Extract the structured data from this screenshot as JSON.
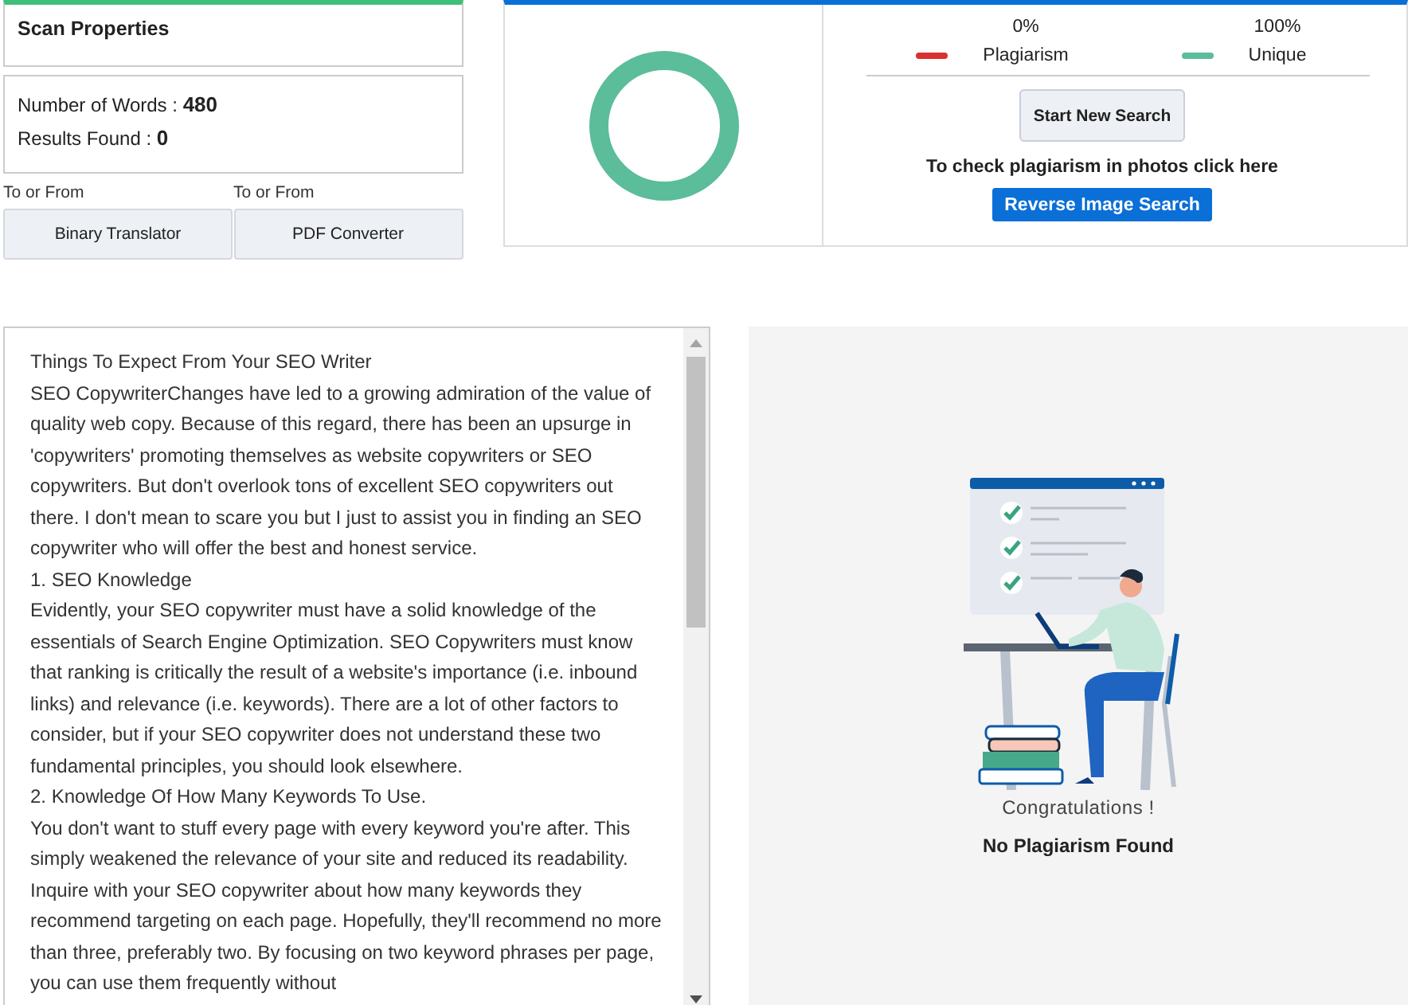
{
  "scan_properties": {
    "title": "Scan Properties",
    "stats": [
      {
        "label": "Number of Words : ",
        "value": "480"
      },
      {
        "label": "Results Found : ",
        "value": "0"
      }
    ]
  },
  "tools": [
    {
      "caption": "To or From",
      "button": "Binary Translator"
    },
    {
      "caption": "To or From",
      "button": "PDF Converter"
    }
  ],
  "results": {
    "legend": [
      {
        "percent": "0%",
        "label": "Plagiarism",
        "color": "#d93030"
      },
      {
        "percent": "100%",
        "label": "Unique",
        "color": "#5bbd9a"
      }
    ],
    "start_button": "Start New Search",
    "photo_hint": "To check plagiarism in photos click here",
    "reverse_button": "Reverse Image Search"
  },
  "content_text": [
    "Things To Expect From Your SEO Writer",
    "SEO CopywriterChanges have led to a growing admiration of the value of quality web copy. Because of this regard, there has been an upsurge in 'copywriters' promoting themselves as website copywriters or SEO copywriters. But don't overlook tons of excellent SEO copywriters out there. I don't mean to scare you but I just to assist you in finding an SEO copywriter who will offer the best and honest service.",
    "1. SEO Knowledge",
    "Evidently, your SEO copywriter must have a solid knowledge of the essentials of Search Engine Optimization. SEO Copywriters must know that ranking is critically the result of a website's importance (i.e. inbound links) and relevance (i.e. keywords). There are a lot of other factors to consider, but if your SEO copywriter does not understand these two fundamental principles, you should look elsewhere.",
    "2. Knowledge Of How Many Keywords To Use.",
    "You don't want to stuff every page with every keyword you're after. This simply weakened the relevance of your site and reduced its readability. Inquire with your SEO copywriter about how many keywords they recommend targeting on each page. Hopefully, they'll recommend no more than three, preferably two. By focusing on two keyword phrases per page, you can use them frequently without"
  ],
  "outcome": {
    "message": "Congratulations !",
    "result": "No Plagiarism Found"
  }
}
